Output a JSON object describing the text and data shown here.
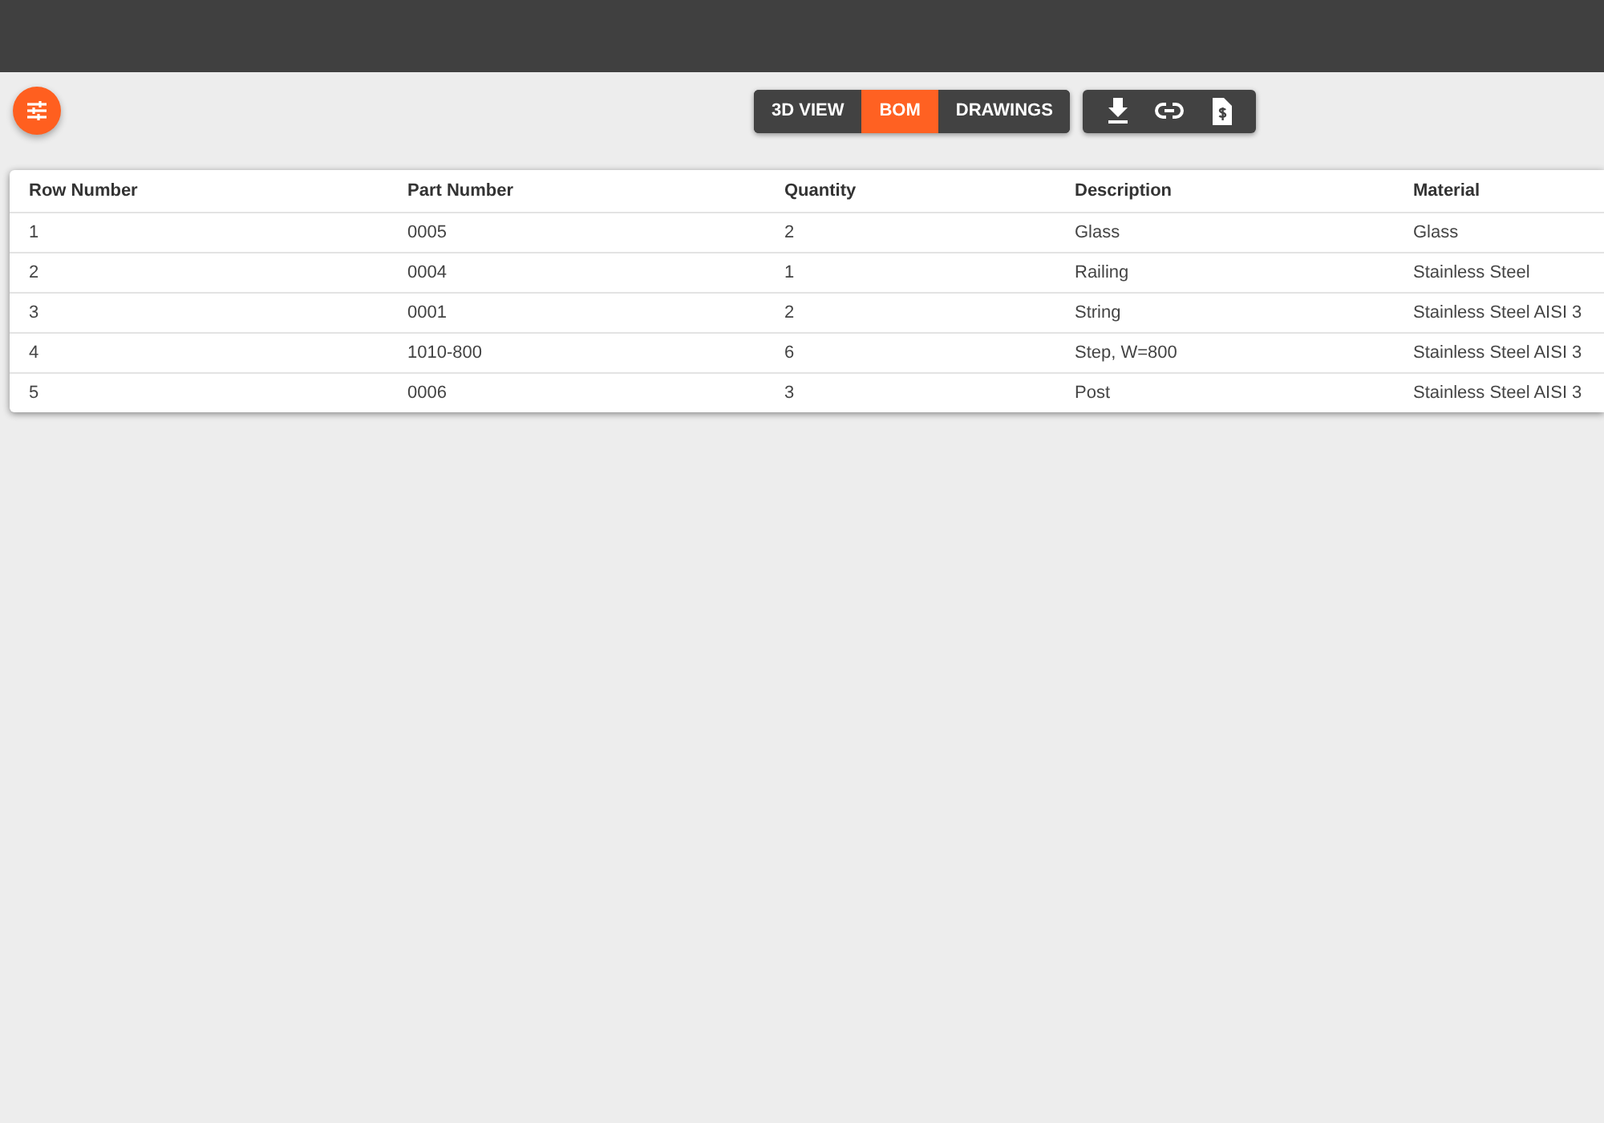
{
  "view_tabs": [
    {
      "label": "3D VIEW",
      "selected": false
    },
    {
      "label": "BOM",
      "selected": true
    },
    {
      "label": "DRAWINGS",
      "selected": false
    }
  ],
  "table": {
    "columns": [
      "Row Number",
      "Part Number",
      "Quantity",
      "Description",
      "Material"
    ],
    "rows": [
      [
        "1",
        "0005",
        "2",
        "Glass",
        "Glass"
      ],
      [
        "2",
        "0004",
        "1",
        "Railing",
        "Stainless Steel"
      ],
      [
        "3",
        "0001",
        "2",
        "String",
        "Stainless Steel AISI 3"
      ],
      [
        "4",
        "1010-800",
        "6",
        "Step, W=800",
        "Stainless Steel AISI 3"
      ],
      [
        "5",
        "0006",
        "3",
        "Post",
        "Stainless Steel AISI 3"
      ]
    ]
  }
}
